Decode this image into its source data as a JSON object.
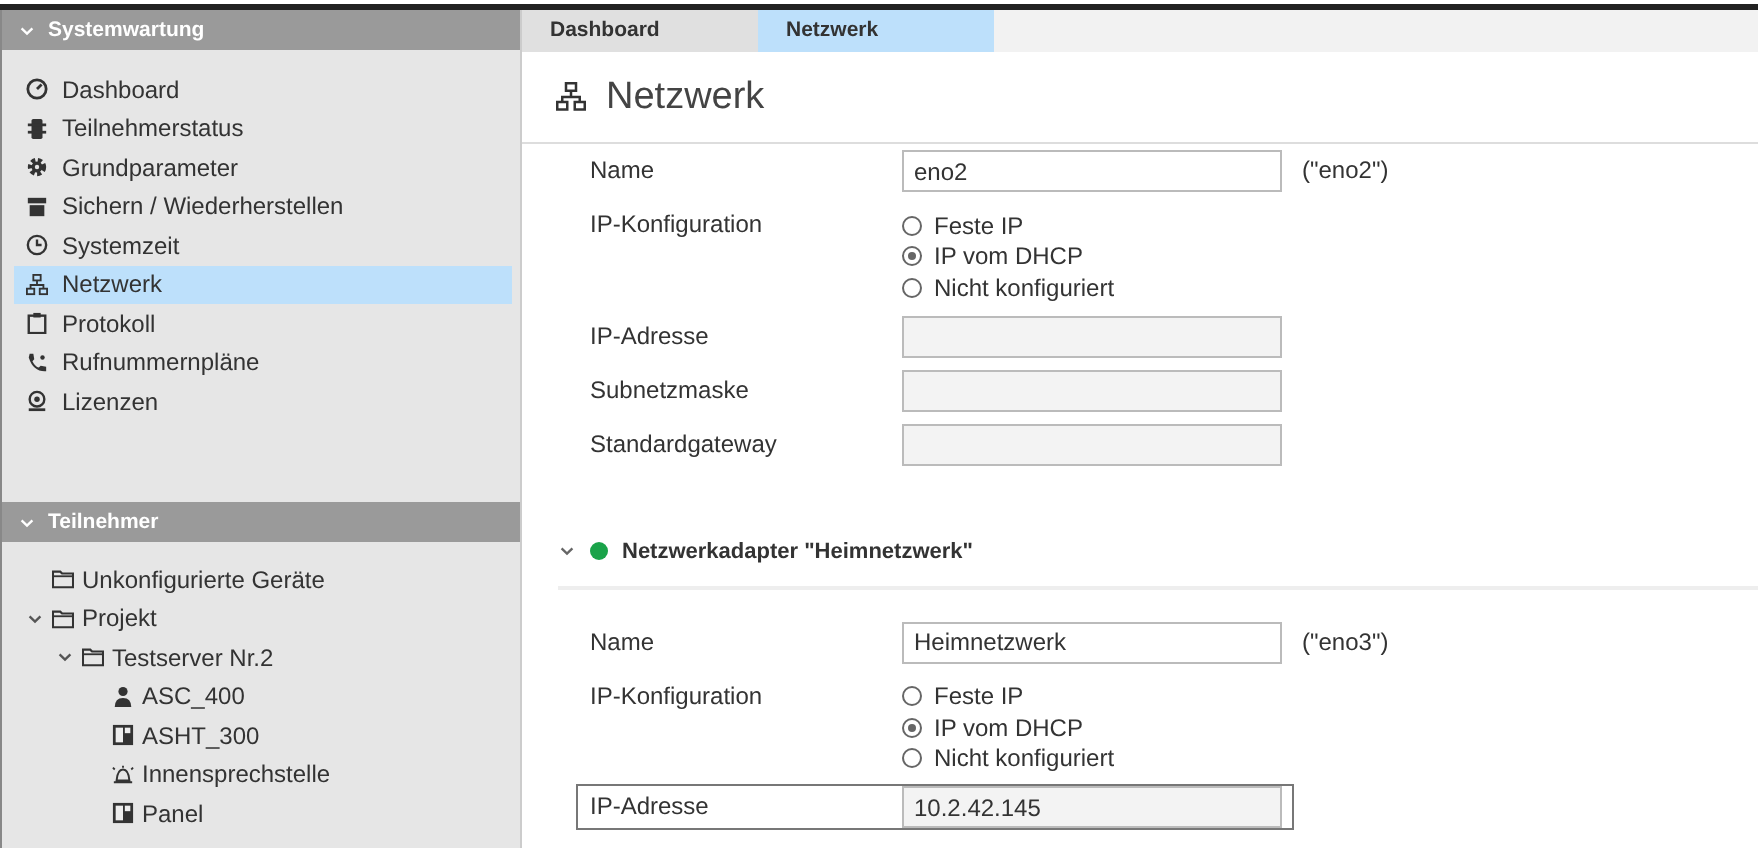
{
  "sidebar": {
    "sections": [
      {
        "title": "Systemwartung",
        "expanded": true,
        "items": [
          {
            "label": "Dashboard",
            "selected": false
          },
          {
            "label": "Teilnehmerstatus",
            "selected": false
          },
          {
            "label": "Grundparameter",
            "selected": false
          },
          {
            "label": "Sichern / Wiederherstellen",
            "selected": false
          },
          {
            "label": "Systemzeit",
            "selected": false
          },
          {
            "label": "Netzwerk",
            "selected": true
          },
          {
            "label": "Protokoll",
            "selected": false
          },
          {
            "label": "Rufnummernpläne",
            "selected": false
          },
          {
            "label": "Lizenzen",
            "selected": false
          }
        ]
      },
      {
        "title": "Teilnehmer",
        "expanded": true,
        "tree": [
          {
            "label": "Unkonfigurierte Geräte"
          },
          {
            "label": "Projekt",
            "expanded": true,
            "children": [
              {
                "label": "Testserver Nr.2",
                "expanded": true,
                "children": [
                  {
                    "label": "ASC_400"
                  },
                  {
                    "label": "ASHT_300"
                  },
                  {
                    "label": "Innensprechstelle"
                  },
                  {
                    "label": "Panel"
                  }
                ]
              }
            ]
          }
        ]
      }
    ]
  },
  "tabs": [
    {
      "label": "Dashboard",
      "selected": false
    },
    {
      "label": "Netzwerk",
      "selected": true
    }
  ],
  "page": {
    "title": "Netzwerk"
  },
  "adapters": [
    {
      "fields": [
        {
          "kind": "text",
          "label": "Name",
          "value": "eno2",
          "note": "(\"eno2\")"
        },
        {
          "kind": "radio",
          "label": "IP-Konfiguration",
          "options": [
            {
              "label": "Feste IP",
              "selected": false
            },
            {
              "label": "IP vom DHCP",
              "selected": true
            },
            {
              "label": "Nicht konfiguriert",
              "selected": false
            }
          ]
        },
        {
          "kind": "readonly",
          "label": "IP-Adresse",
          "highlighted": false
        },
        {
          "kind": "readonly",
          "label": "Subnetzmaske",
          "highlighted": false
        },
        {
          "kind": "readonly",
          "label": "Standardgateway",
          "highlighted": false
        }
      ]
    },
    {
      "title": "Netzwerkadapter \"Heimnetzwerk\"",
      "expanded": true,
      "color": "#1aa34a",
      "fields": [
        {
          "kind": "text",
          "label": "Name",
          "value": "Heimnetzwerk",
          "note": "(\"eno3\")"
        },
        {
          "kind": "radio",
          "label": "IP-Konfiguration",
          "options": [
            {
              "label": "Feste IP",
              "selected": false
            },
            {
              "label": "IP vom DHCP",
              "selected": true
            },
            {
              "label": "Nicht konfiguriert",
              "selected": false
            }
          ]
        },
        {
          "kind": "readonly",
          "label": "IP-Adresse",
          "value": "10.2.42.145",
          "highlighted": true
        }
      ]
    }
  ]
}
